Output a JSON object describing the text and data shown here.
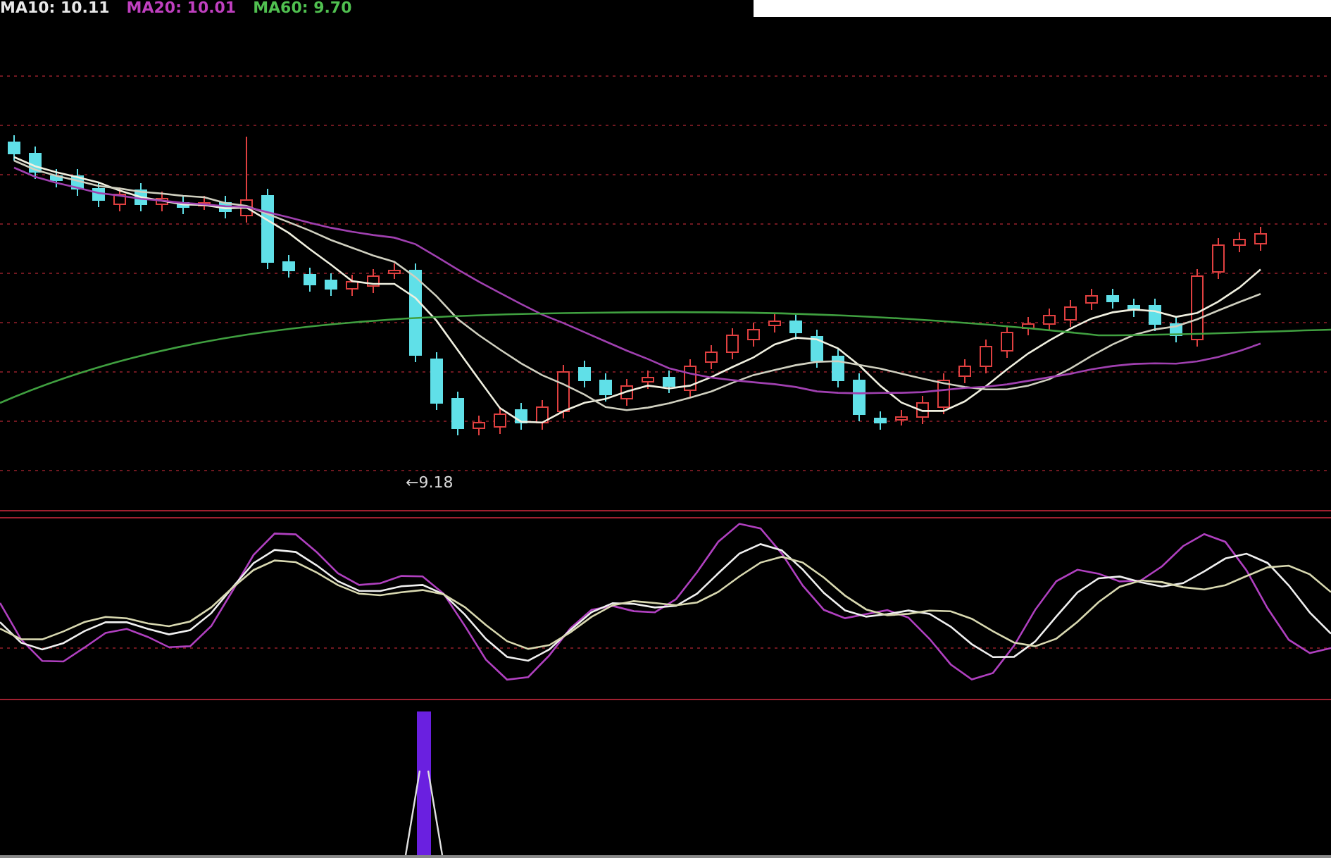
{
  "legend": [
    {
      "label": "MA10: 10.11",
      "color": "#e8e8e8"
    },
    {
      "label": "MA20: 10.01",
      "color": "#c040c0"
    },
    {
      "label": "MA60: 9.70",
      "color": "#50c050"
    }
  ],
  "price_chart": {
    "low_marker": "←9.18"
  }
}
